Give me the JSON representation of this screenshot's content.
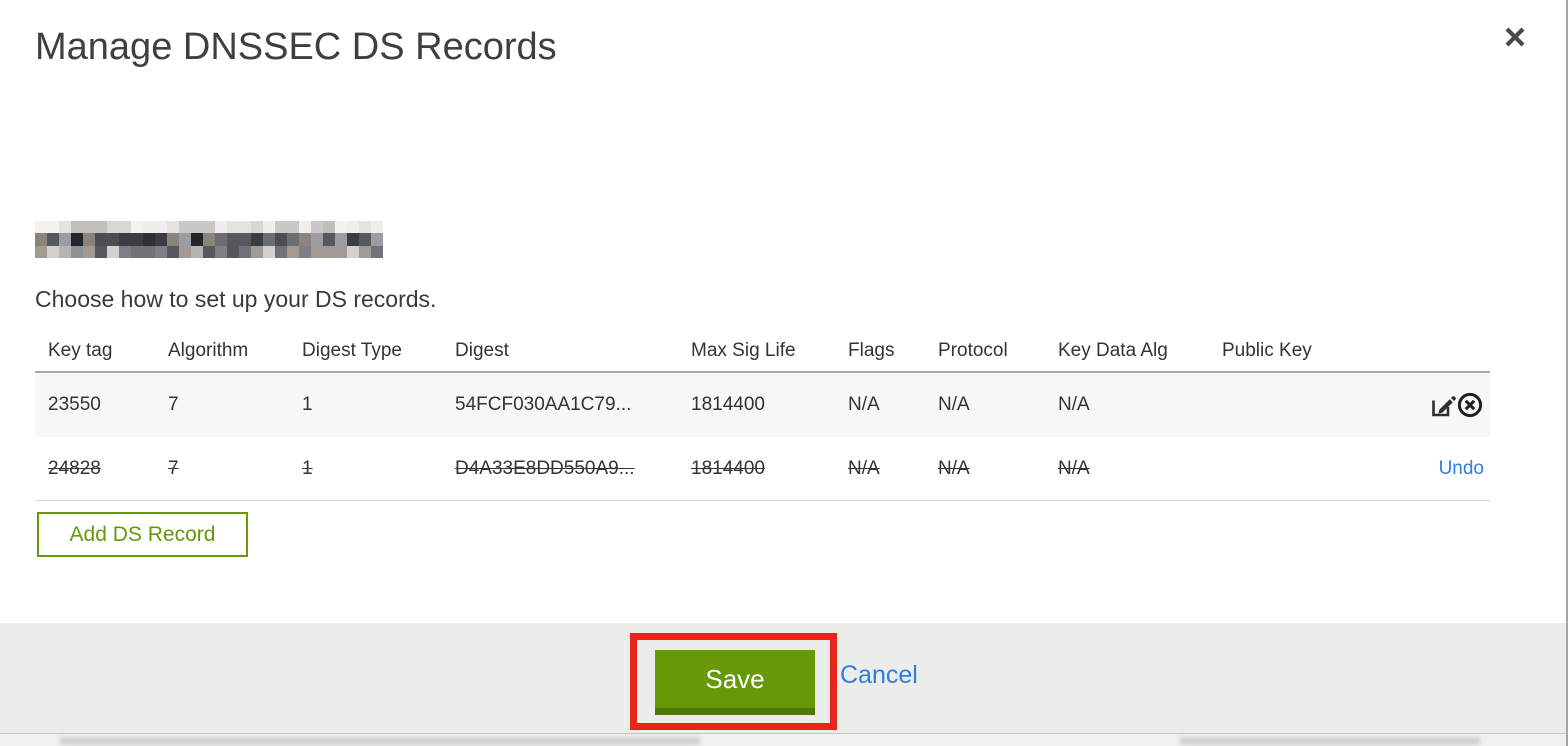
{
  "modal": {
    "title": "Manage DNSSEC DS Records",
    "subtitle": "Choose how to set up your DS records.",
    "domain_name_redacted": "pixelated-redaction",
    "close_icon": "close-x"
  },
  "table": {
    "columns": [
      "Key tag",
      "Algorithm",
      "Digest Type",
      "Digest",
      "Max Sig Life",
      "Flags",
      "Protocol",
      "Key Data Alg",
      "Public Key"
    ],
    "rows": [
      {
        "state": "active",
        "values": [
          "23550",
          "7",
          "1",
          "54FCF030AA1C79...",
          "1814400",
          "N/A",
          "N/A",
          "N/A",
          ""
        ],
        "actions": [
          "edit-icon",
          "delete-icon"
        ]
      },
      {
        "state": "deleted-strikethrough",
        "values": [
          "24828",
          "7",
          "1",
          "D4A33E8DD550A9...",
          "1814400",
          "N/A",
          "N/A",
          "N/A",
          ""
        ],
        "action_label": "Undo"
      }
    ]
  },
  "buttons": {
    "add_record": "Add DS Record",
    "save": "Save",
    "cancel": "Cancel"
  },
  "colors": {
    "accent_green": "#669905",
    "accent_green_dark": "#4d7a04",
    "link_blue": "#2f7de1",
    "annotation_red": "#e8251c",
    "footer_gray": "#ececea",
    "row_stripe": "#f7f7f6",
    "text_dark": "#3f3f3f"
  },
  "redaction_mosaic": {
    "cols": 29,
    "row_palettes": [
      [
        "#efeeec",
        "#e4e3e1",
        "#d8d7d4",
        "#c9c8c6",
        "#f3f2f0",
        "#bfbfbd"
      ],
      [
        "#3a3d42",
        "#55585e",
        "#2e3035",
        "#6a6d72",
        "#8b847c",
        "#4a4d52",
        "#9a9da1",
        "#23252a"
      ],
      [
        "#8d9095",
        "#6f7277",
        "#b5b4b1",
        "#55575c",
        "#d2d1ce",
        "#7c7f85",
        "#a09a92"
      ]
    ]
  }
}
